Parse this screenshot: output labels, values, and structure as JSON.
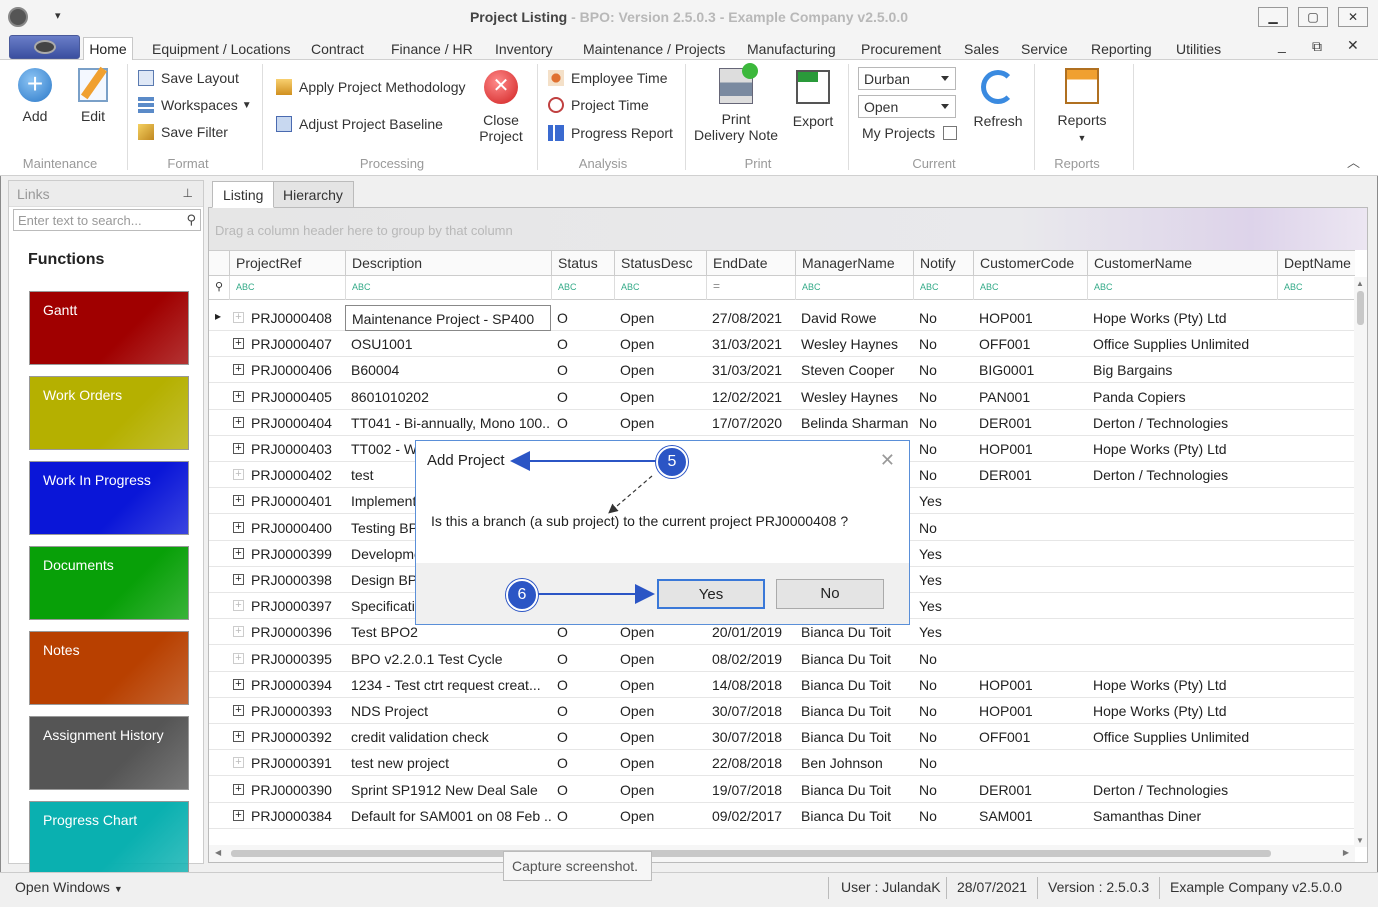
{
  "window": {
    "title": "Project Listing",
    "subtitle": " - BPO: Version 2.5.0.3 - Example Company v2.5.0.0",
    "min": "▁",
    "max": "▢",
    "close": "✕"
  },
  "menu": [
    "Home",
    "Equipment / Locations",
    "Contract",
    "Finance / HR",
    "Inventory",
    "Maintenance / Projects",
    "Manufacturing",
    "Procurement",
    "Sales",
    "Service",
    "Reporting",
    "Utilities"
  ],
  "ribbon": {
    "maintenance": {
      "label": "Maintenance",
      "add": "Add",
      "edit": "Edit"
    },
    "format": {
      "label": "Format",
      "save_layout": "Save Layout",
      "workspaces": "Workspaces",
      "save_filter": "Save Filter"
    },
    "processing": {
      "label": "Processing",
      "apply": "Apply Project Methodology",
      "adjust": "Adjust Project Baseline",
      "close_1": "Close",
      "close_2": "Project"
    },
    "analysis": {
      "label": "Analysis",
      "employee_time": "Employee Time",
      "project_time": "Project Time",
      "progress_report": "Progress Report"
    },
    "print": {
      "label": "Print",
      "print_1": "Print",
      "print_2": "Delivery Note",
      "export": "Export"
    },
    "current": {
      "label": "Current",
      "combo1": "Durban",
      "combo2": "Open",
      "my_projects": "My Projects",
      "refresh": "Refresh"
    },
    "reports": {
      "label": "Reports",
      "reports": "Reports"
    }
  },
  "links": {
    "header": "Links",
    "search_placeholder": "Enter text to search...",
    "functions": "Functions",
    "tiles": [
      {
        "label": "Gantt",
        "color": "#a00000"
      },
      {
        "label": "Work Orders",
        "color": "#b5b000"
      },
      {
        "label": "Work In Progress",
        "color": "#0a16d8"
      },
      {
        "label": "Documents",
        "color": "#08a008"
      },
      {
        "label": "Notes",
        "color": "#b84000"
      },
      {
        "label": "Assignment History",
        "color": "#555555"
      },
      {
        "label": "Progress Chart",
        "color": "#0ab0b0"
      }
    ]
  },
  "tabs": [
    "Listing",
    "Hierarchy"
  ],
  "group_hint": "Drag a column header here to group by that column",
  "columns": [
    "ProjectRef",
    "Description",
    "Status",
    "StatusDesc",
    "EndDate",
    "ManagerName",
    "Notify",
    "CustomerCode",
    "CustomerName",
    "DeptName"
  ],
  "rows": [
    [
      "PRJ0000408",
      "Maintenance Project - SP400",
      "O",
      "Open",
      "27/08/2021",
      "David Rowe",
      "No",
      "HOP001",
      "Hope Works (Pty) Ltd",
      ""
    ],
    [
      "PRJ0000407",
      "OSU1001",
      "O",
      "Open",
      "31/03/2021",
      "Wesley Haynes",
      "No",
      "OFF001",
      "Office Supplies Unlimited",
      ""
    ],
    [
      "PRJ0000406",
      "B60004",
      "O",
      "Open",
      "31/03/2021",
      "Steven Cooper",
      "No",
      "BIG0001",
      "Big Bargains",
      ""
    ],
    [
      "PRJ0000405",
      "8601010202",
      "O",
      "Open",
      "12/02/2021",
      "Wesley Haynes",
      "No",
      "PAN001",
      "Panda Copiers",
      ""
    ],
    [
      "PRJ0000404",
      "TT041 - Bi-annually, Mono 100...",
      "O",
      "Open",
      "17/07/2020",
      "Belinda Sharman",
      "No",
      "DER001",
      "Derton / Technologies",
      ""
    ],
    [
      "PRJ0000403",
      "TT002 - W",
      "",
      "",
      "",
      "",
      "No",
      "HOP001",
      "Hope Works (Pty) Ltd",
      ""
    ],
    [
      "PRJ0000402",
      "test",
      "",
      "",
      "",
      "",
      "No",
      "DER001",
      "Derton / Technologies",
      ""
    ],
    [
      "PRJ0000401",
      "Implementa",
      "",
      "",
      "",
      "",
      "Yes",
      "",
      "",
      ""
    ],
    [
      "PRJ0000400",
      "Testing BP",
      "",
      "",
      "",
      "",
      "No",
      "",
      "",
      ""
    ],
    [
      "PRJ0000399",
      "Developme",
      "",
      "",
      "",
      "",
      "Yes",
      "",
      "",
      ""
    ],
    [
      "PRJ0000398",
      "Design BPO",
      "",
      "",
      "",
      "",
      "Yes",
      "",
      "",
      ""
    ],
    [
      "PRJ0000397",
      "Specificatio",
      "",
      "",
      "",
      "",
      "Yes",
      "",
      "",
      ""
    ],
    [
      "PRJ0000396",
      "Test BPO2",
      "O",
      "Open",
      "20/01/2019",
      "Bianca Du Toit",
      "Yes",
      "",
      "",
      ""
    ],
    [
      "PRJ0000395",
      "BPO v2.2.0.1 Test Cycle",
      "O",
      "Open",
      "08/02/2019",
      "Bianca Du Toit",
      "No",
      "",
      "",
      ""
    ],
    [
      "PRJ0000394",
      "1234 - Test ctrt request creat...",
      "O",
      "Open",
      "14/08/2018",
      "Bianca Du Toit",
      "No",
      "HOP001",
      "Hope Works (Pty) Ltd",
      ""
    ],
    [
      "PRJ0000393",
      "NDS Project",
      "O",
      "Open",
      "30/07/2018",
      "Bianca Du Toit",
      "No",
      "HOP001",
      "Hope Works (Pty) Ltd",
      ""
    ],
    [
      "PRJ0000392",
      "credit validation check",
      "O",
      "Open",
      "30/07/2018",
      "Bianca Du Toit",
      "No",
      "OFF001",
      "Office Supplies Unlimited",
      ""
    ],
    [
      "PRJ0000391",
      "test new project",
      "O",
      "Open",
      "22/08/2018",
      "Ben Johnson",
      "No",
      "",
      "",
      ""
    ],
    [
      "PRJ0000390",
      "Sprint SP1912 New Deal Sale",
      "O",
      "Open",
      "19/07/2018",
      "Bianca Du Toit",
      "No",
      "DER001",
      "Derton / Technologies",
      ""
    ],
    [
      "PRJ0000384",
      "Default for SAM001 on 08 Feb ...",
      "O",
      "Open",
      "09/02/2017",
      "Bianca Du Toit",
      "No",
      "SAM001",
      "Samanthas Diner",
      ""
    ]
  ],
  "expand_light": [
    0,
    6,
    11,
    12,
    13,
    17
  ],
  "dialog": {
    "title": "Add Project",
    "message": "Is this a branch (a sub project) to the current project PRJ0000408 ?",
    "yes": "Yes",
    "no": "No"
  },
  "callouts": [
    "5",
    "6"
  ],
  "tooltip": "Capture screenshot.",
  "status": {
    "open_windows": "Open Windows",
    "user": "User : JulandaK",
    "date": "28/07/2021",
    "version": "Version : 2.5.0.3",
    "company": "Example Company v2.5.0.0"
  }
}
